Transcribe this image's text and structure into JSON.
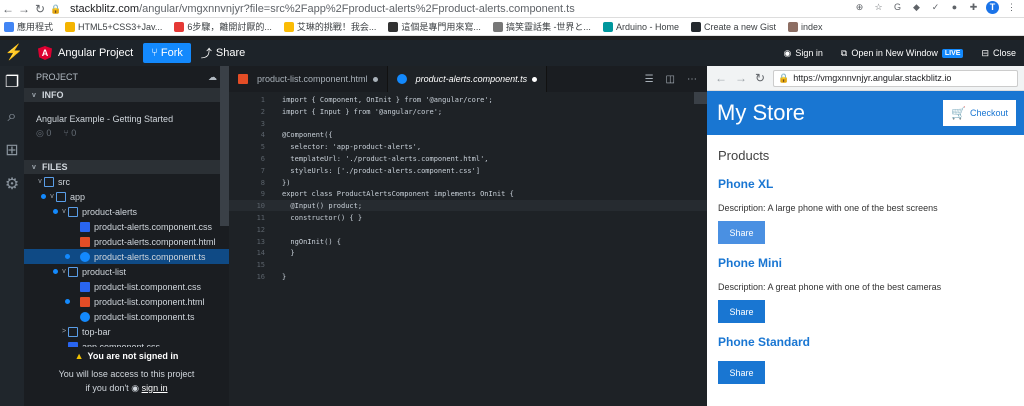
{
  "browser": {
    "address": "stackblitz.com/angular/vmgxnnvnjyr?file=src%2Fapp%2Fproduct-alerts%2Fproduct-alerts.component.ts",
    "address_host": "stackblitz.com",
    "address_path": "/angular/vmgxnnvnjyr?file=src%2Fapp%2Fproduct-alerts%2Fproduct-alerts.component.ts",
    "profile_initial": "T",
    "bookmarks": [
      "應用程式",
      "HTML5+CSS3+Jav...",
      "6步驟，離開討厭的...",
      "艾琳的挑戰！我会...",
      "這個是專門用來寫...",
      "搞笑靈話集 -世界と...",
      "Arduino - Home",
      "Create a new Gist",
      "index"
    ]
  },
  "header": {
    "project": "Angular Project",
    "fork": "Fork",
    "share": "Share",
    "sign_in": "Sign in",
    "open_new_window": "Open in New Window",
    "live_badge": "LIVE",
    "close": "Close"
  },
  "sidebar": {
    "title": "PROJECT",
    "info_header": "INFO",
    "info_title": "Angular Example - Getting Started",
    "stars": "0",
    "forks": "0",
    "files_header": "FILES",
    "tree": [
      {
        "label": "src",
        "type": "folder",
        "chev": "v",
        "depth": 0,
        "dot": false,
        "sel": false
      },
      {
        "label": "app",
        "type": "folder",
        "chev": "v",
        "depth": 1,
        "dot": true,
        "sel": false
      },
      {
        "label": "product-alerts",
        "type": "folder",
        "chev": "v",
        "depth": 2,
        "dot": true,
        "sel": false
      },
      {
        "label": "product-alerts.component.css",
        "type": "css",
        "chev": "",
        "depth": 3,
        "dot": false,
        "sel": false
      },
      {
        "label": "product-alerts.component.html",
        "type": "html",
        "chev": "",
        "depth": 3,
        "dot": false,
        "sel": false
      },
      {
        "label": "product-alerts.component.ts",
        "type": "ts",
        "chev": "",
        "depth": 3,
        "dot": true,
        "sel": true
      },
      {
        "label": "product-list",
        "type": "folder",
        "chev": "v",
        "depth": 2,
        "dot": true,
        "sel": false
      },
      {
        "label": "product-list.component.css",
        "type": "css",
        "chev": "",
        "depth": 3,
        "dot": false,
        "sel": false
      },
      {
        "label": "product-list.component.html",
        "type": "html",
        "chev": "",
        "depth": 3,
        "dot": true,
        "sel": false
      },
      {
        "label": "product-list.component.ts",
        "type": "ts",
        "chev": "",
        "depth": 3,
        "dot": false,
        "sel": false
      },
      {
        "label": "top-bar",
        "type": "folder",
        "chev": ">",
        "depth": 2,
        "dot": false,
        "sel": false
      },
      {
        "label": "app.component.css",
        "type": "css",
        "chev": "",
        "depth": 2,
        "dot": false,
        "sel": false
      }
    ],
    "not_signed_title": "You are not signed in",
    "not_signed_line1": "You will lose access to this project",
    "not_signed_line2": "if you don't",
    "sign_in_link": "sign in"
  },
  "editor": {
    "tabs": [
      {
        "label": "product-list.component.html",
        "active": false
      },
      {
        "label": "product-alerts.component.ts",
        "active": true
      }
    ],
    "lines": [
      {
        "n": "1",
        "text": "import { Component, OnInit } from '@angular/core';"
      },
      {
        "n": "2",
        "text": "import { Input } from '@angular/core';"
      },
      {
        "n": "3",
        "text": ""
      },
      {
        "n": "4",
        "text": "@Component({"
      },
      {
        "n": "5",
        "text": "  selector: 'app-product-alerts',"
      },
      {
        "n": "6",
        "text": "  templateUrl: './product-alerts.component.html',"
      },
      {
        "n": "7",
        "text": "  styleUrls: ['./product-alerts.component.css']"
      },
      {
        "n": "8",
        "text": "})"
      },
      {
        "n": "9",
        "text": "export class ProductAlertsComponent implements OnInit {"
      },
      {
        "n": "10",
        "text": "  @Input() product;"
      },
      {
        "n": "11",
        "text": "  constructor() { }"
      },
      {
        "n": "12",
        "text": ""
      },
      {
        "n": "13",
        "text": "  ngOnInit() {"
      },
      {
        "n": "14",
        "text": "  }"
      },
      {
        "n": "15",
        "text": ""
      },
      {
        "n": "16",
        "text": "}"
      }
    ]
  },
  "preview": {
    "url": "https://vmgxnnvnjyr.angular.stackblitz.io",
    "store_title": "My Store",
    "checkout": "Checkout",
    "products_heading": "Products",
    "products": [
      {
        "name": "Phone XL",
        "desc": "Description: A large phone with one of the best screens",
        "share": "Share"
      },
      {
        "name": "Phone Mini",
        "desc": "Description: A great phone with one of the best cameras",
        "share": "Share"
      },
      {
        "name": "Phone Standard",
        "desc": "",
        "share": "Share"
      }
    ]
  },
  "colors": {
    "accent": "#1389fd",
    "store_blue": "#1976d2",
    "angular_red": "#dd0031"
  }
}
